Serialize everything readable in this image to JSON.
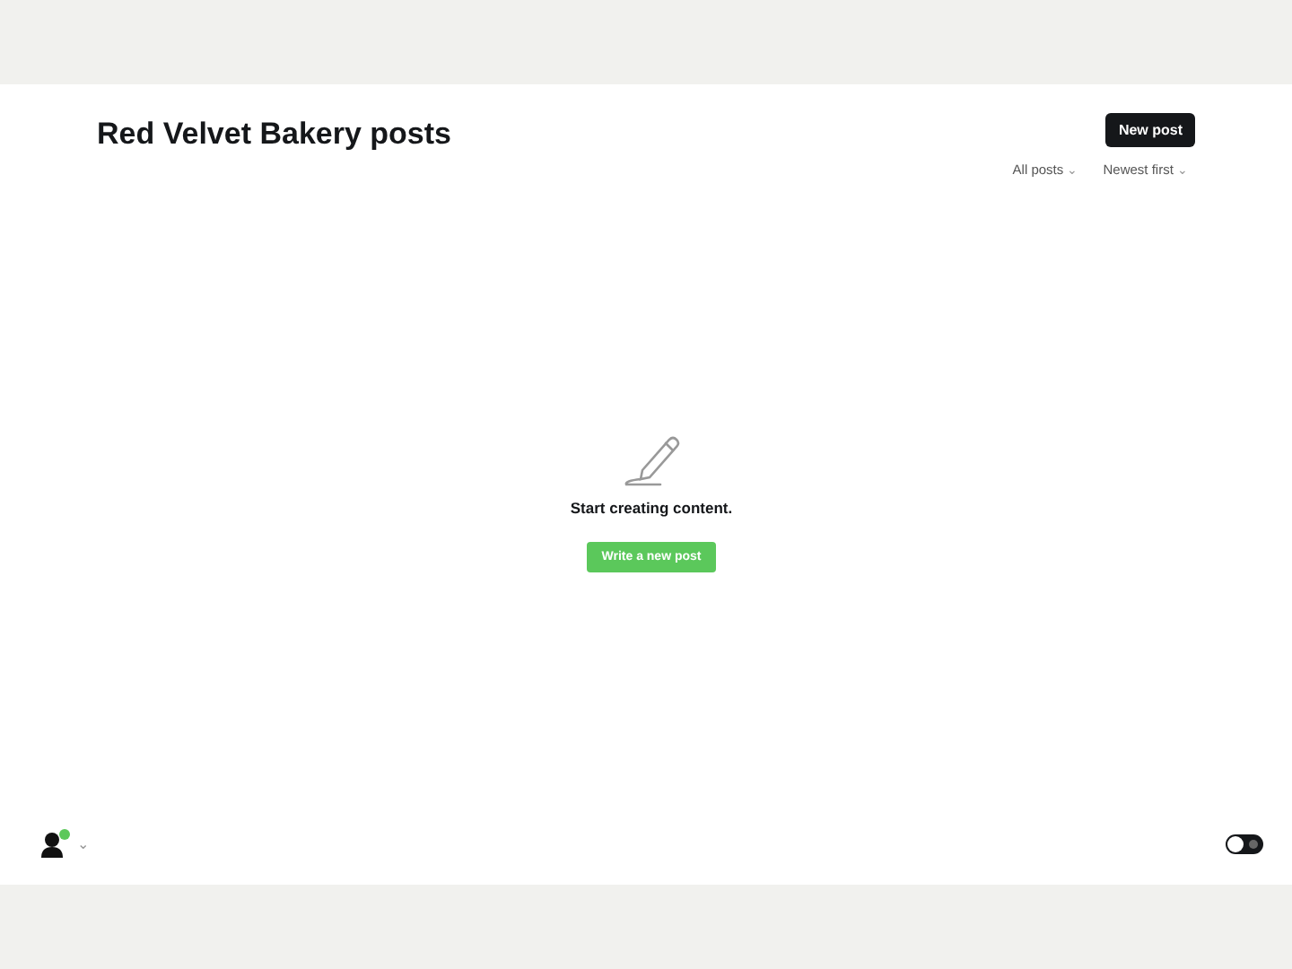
{
  "header": {
    "title": "Red Velvet Bakery posts",
    "new_button": "New post"
  },
  "filters": [
    {
      "label": "All posts",
      "caret": "⌄"
    },
    {
      "label": "Newest first",
      "caret": "⌄"
    }
  ],
  "empty_state": {
    "message": "Start creating content.",
    "button": "Write a new post"
  },
  "footer": {
    "user": {
      "online": true,
      "caret": "⌄"
    },
    "theme_toggle": {
      "on": false
    }
  }
}
